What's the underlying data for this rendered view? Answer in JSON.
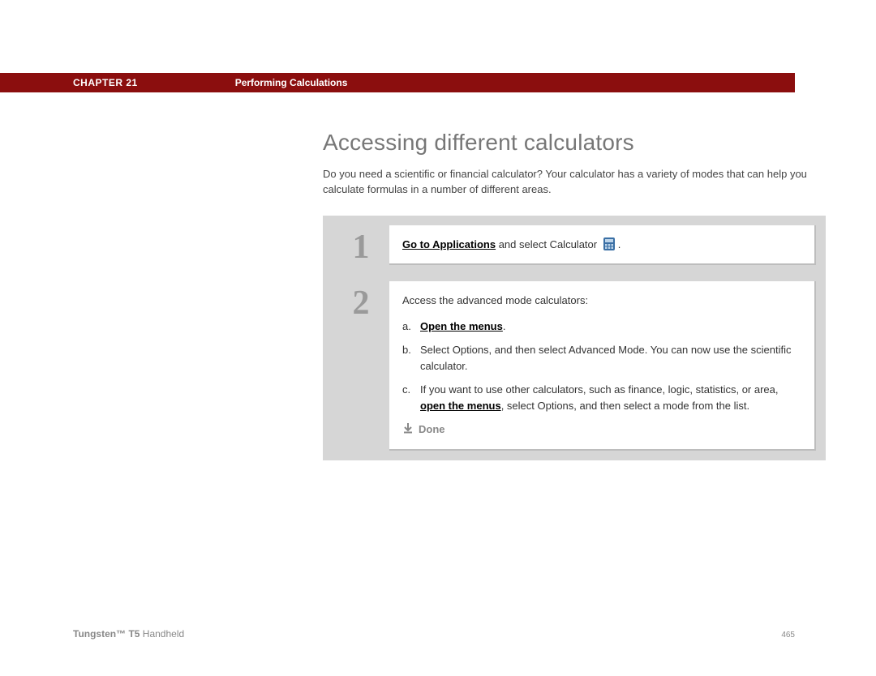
{
  "header": {
    "chapter": "CHAPTER 21",
    "section": "Performing Calculations"
  },
  "title": "Accessing different calculators",
  "intro": "Do you need a scientific or financial calculator? Your calculator has a variety of modes that can help you calculate formulas in a number of different areas.",
  "step1": {
    "number": "1",
    "link": "Go to Applications",
    "text_after_link": " and select Calculator ",
    "period": "."
  },
  "step2": {
    "number": "2",
    "lead": "Access the advanced mode calculators:",
    "a": {
      "label": "a.",
      "link": "Open the menus",
      "suffix": "."
    },
    "b": {
      "label": "b.",
      "text": "Select Options, and then select Advanced Mode. You can now use the scientific calculator."
    },
    "c": {
      "label": "c.",
      "text_before": "If you want to use other calculators, such as finance, logic, statistics, or area, ",
      "link": "open the menus",
      "text_after": ", select Options, and then select a mode from the list."
    },
    "done": "Done"
  },
  "footer": {
    "product_strong": "Tungsten™ T5",
    "product_rest": " Handheld",
    "page": "465"
  }
}
